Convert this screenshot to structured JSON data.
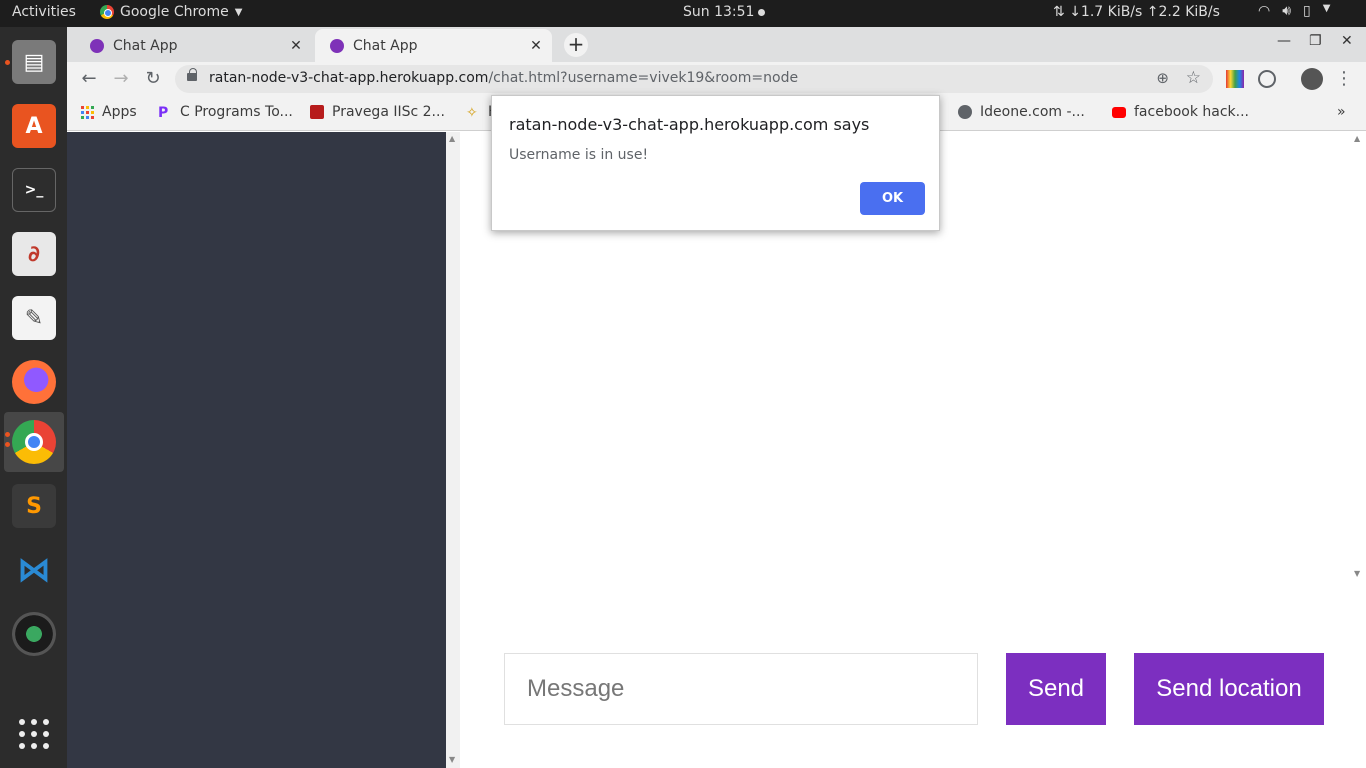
{
  "topbar": {
    "activities": "Activities",
    "app_name": "Google Chrome",
    "clock": "Sun 13:51",
    "network": "↓1.7 KiB/s ↑2.2 KiB/s"
  },
  "dock": {
    "items": [
      {
        "name": "files",
        "color": "#7a7a7a"
      },
      {
        "name": "software-center",
        "color": "#e95420"
      },
      {
        "name": "terminal",
        "color": "#2d2d2d"
      },
      {
        "name": "document-viewer",
        "color": "#e8e8e8"
      },
      {
        "name": "text-editor",
        "color": "#f3f3f3"
      },
      {
        "name": "firefox",
        "color": "#ff7139"
      },
      {
        "name": "chrome",
        "color": "#4285f4"
      },
      {
        "name": "sublime-text",
        "color": "#3a3a3a"
      },
      {
        "name": "vscode",
        "color": "#2a8ad4"
      },
      {
        "name": "camera",
        "color": "#1b1b1b"
      }
    ]
  },
  "tabs": [
    {
      "label": "Chat App"
    },
    {
      "label": "Chat App"
    }
  ],
  "toolbar": {
    "url_host": "ratan-node-v3-chat-app.herokuapp.com",
    "url_path": "/chat.html?username=vivek19&room=node"
  },
  "bookmarks": [
    {
      "label": "Apps"
    },
    {
      "label": "C Programs To..."
    },
    {
      "label": "Pravega IISc 2..."
    },
    {
      "label": "H"
    },
    {
      "label": "Ideone.com -..."
    },
    {
      "label": "facebook hack..."
    }
  ],
  "alert": {
    "title": "ratan-node-v3-chat-app.herokuapp.com says",
    "message": "Username is in use!",
    "ok_label": "OK"
  },
  "composer": {
    "placeholder": "Message",
    "send_label": "Send",
    "location_label": "Send location"
  },
  "colors": {
    "sidebar": "#333744",
    "accent_purple": "#7c2fc0",
    "alert_button": "#4a6ff0",
    "ubuntu_orange": "#e95420"
  }
}
